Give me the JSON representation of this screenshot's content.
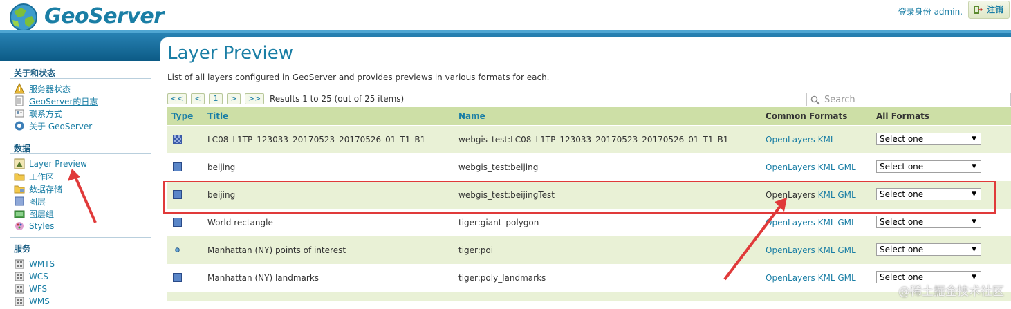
{
  "header": {
    "brand": "GeoServer",
    "login_text": "登录身份 admin.",
    "logout_label": "注销"
  },
  "sidebar": {
    "sections": [
      {
        "title": "关于和状态",
        "items": [
          {
            "label": "服务器状态",
            "icon": "server-status-icon"
          },
          {
            "label": "GeoServer的日志",
            "icon": "log-icon"
          },
          {
            "label": "联系方式",
            "icon": "contact-icon"
          },
          {
            "label": "关于 GeoServer",
            "icon": "about-icon"
          }
        ]
      },
      {
        "title": "数据",
        "items": [
          {
            "label": "Layer Preview",
            "icon": "layer-preview-icon"
          },
          {
            "label": "工作区",
            "icon": "folder-icon"
          },
          {
            "label": "数据存储",
            "icon": "datastore-icon"
          },
          {
            "label": "图层",
            "icon": "layer-icon"
          },
          {
            "label": "图层组",
            "icon": "layer-group-icon"
          },
          {
            "label": "Styles",
            "icon": "styles-icon"
          }
        ]
      },
      {
        "title": "服务",
        "items": [
          {
            "label": "WMTS",
            "icon": "service-icon"
          },
          {
            "label": "WCS",
            "icon": "service-icon"
          },
          {
            "label": "WFS",
            "icon": "service-icon"
          },
          {
            "label": "WMS",
            "icon": "service-icon"
          }
        ]
      }
    ]
  },
  "main": {
    "title": "Layer Preview",
    "description": "List of all layers configured in GeoServer and provides previews in various formats for each.",
    "pager": {
      "first": "<<",
      "prev": "<",
      "page": "1",
      "next": ">",
      "last": ">>",
      "info": "Results 1 to 25 (out of 25 items)"
    },
    "search_placeholder": "Search",
    "columns": {
      "type": "Type",
      "title": "Title",
      "name": "Name",
      "common": "Common Formats",
      "all": "All Formats"
    },
    "rows": [
      {
        "type": "raster",
        "title": "LC08_L1TP_123033_20170523_20170526_01_T1_B1",
        "name": "webgis_test:LC08_L1TP_123033_20170523_20170526_01_T1_B1",
        "formats": [
          "OpenLayers",
          "KML"
        ],
        "select": "Select one"
      },
      {
        "type": "polygon",
        "title": "beijing",
        "name": "webgis_test:beijing",
        "formats": [
          "OpenLayers",
          "KML",
          "GML"
        ],
        "select": "Select one"
      },
      {
        "type": "polygon",
        "title": "beijing",
        "name": "webgis_test:beijingTest",
        "formats": [
          "OpenLayers",
          "KML",
          "GML"
        ],
        "select": "Select one"
      },
      {
        "type": "polygon",
        "title": "World rectangle",
        "name": "tiger:giant_polygon",
        "formats": [
          "OpenLayers",
          "KML",
          "GML"
        ],
        "select": "Select one"
      },
      {
        "type": "point",
        "title": "Manhattan (NY) points of interest",
        "name": "tiger:poi",
        "formats": [
          "OpenLayers",
          "KML",
          "GML"
        ],
        "select": "Select one"
      },
      {
        "type": "polygon",
        "title": "Manhattan (NY) landmarks",
        "name": "tiger:poly_landmarks",
        "formats": [
          "OpenLayers",
          "KML",
          "GML"
        ],
        "select": "Select one"
      }
    ]
  },
  "watermark": "@稀土掘金技术社区",
  "colors": {
    "accent": "#1a7ea5",
    "header_band": "#0c5b86",
    "row_alt": "#e9f1d6",
    "table_head": "#cddfa6",
    "annotation": "#e03a3a"
  }
}
